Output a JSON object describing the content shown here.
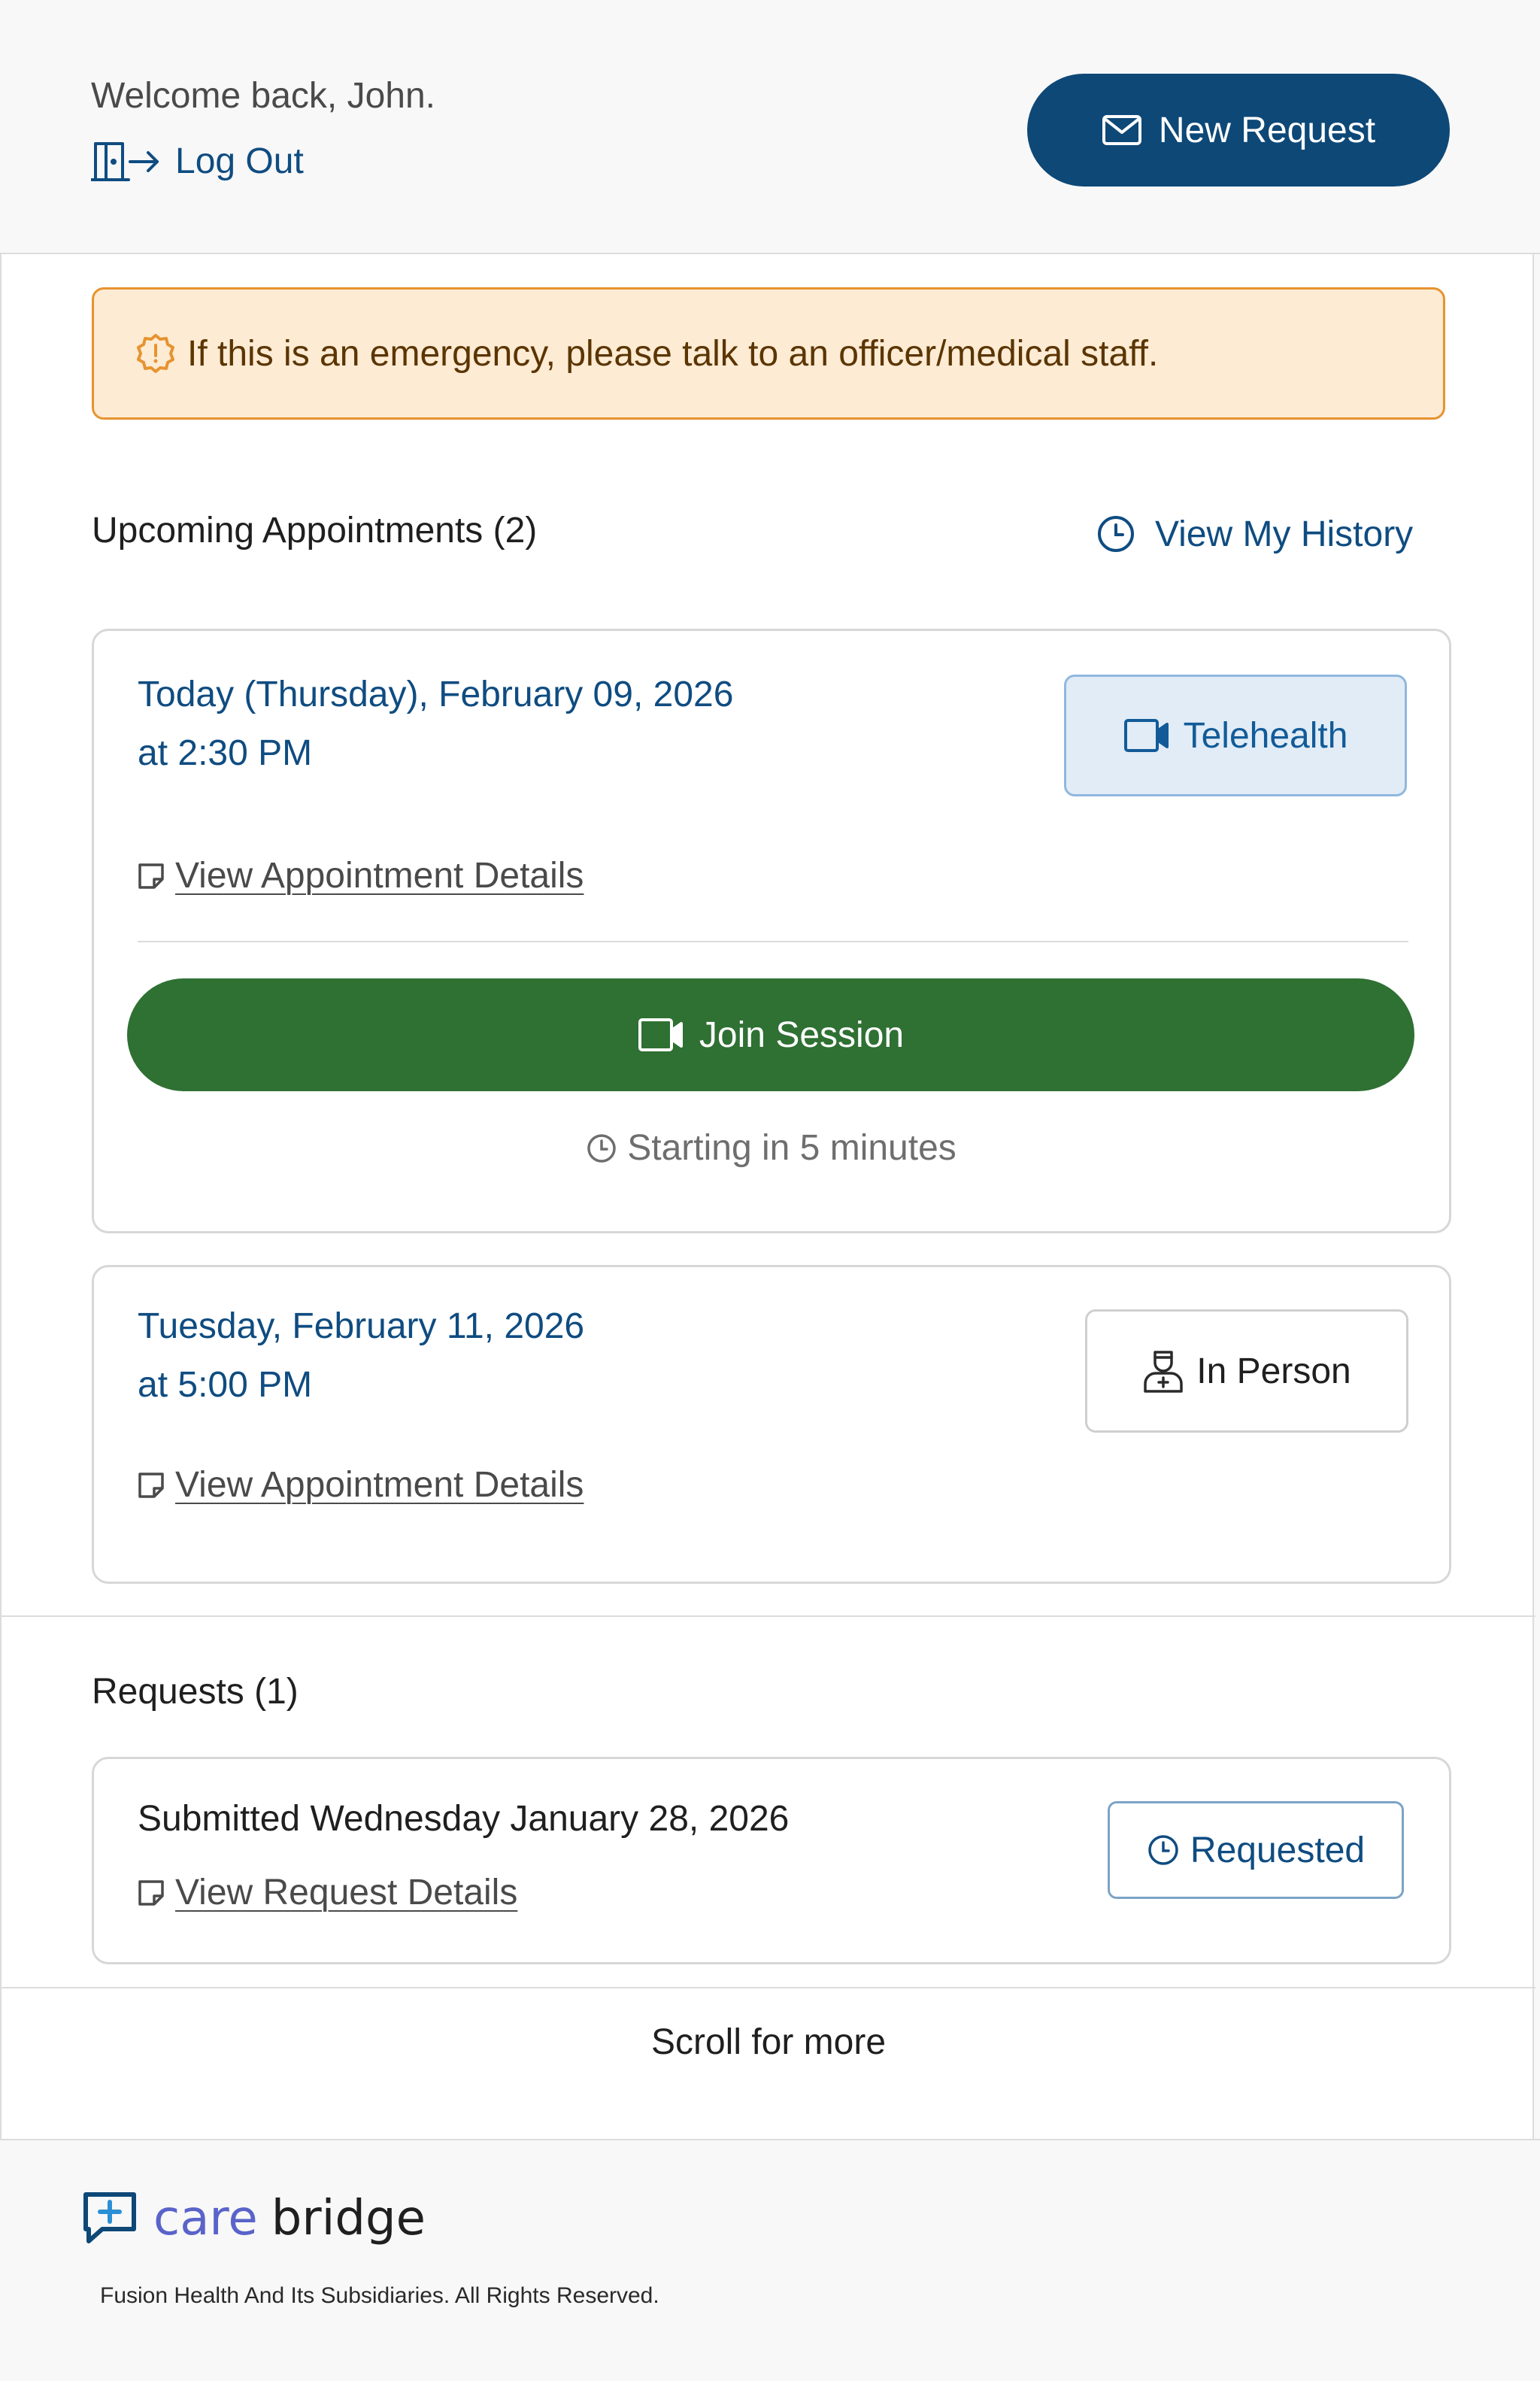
{
  "header": {
    "welcome": "Welcome back, John.",
    "logout_label": "Log Out",
    "new_request_label": "New Request"
  },
  "alert": {
    "text": "If this is an emergency, please talk to an officer/medical staff."
  },
  "appointments": {
    "title": "Upcoming Appointments (2)",
    "history_label": "View My History",
    "items": [
      {
        "date_line": "Today (Thursday), February 09, 2026",
        "time_line": "at 2:30 PM",
        "details_label": "View Appointment Details",
        "type_label": "Telehealth",
        "join_label": "Join Session",
        "starting_text": "Starting in 5 minutes"
      },
      {
        "date_line": "Tuesday, February 11, 2026",
        "time_line": "at 5:00 PM",
        "details_label": "View Appointment Details",
        "type_label": "In Person"
      }
    ]
  },
  "requests": {
    "title": "Requests (1)",
    "items": [
      {
        "submitted": "Submitted Wednesday January 28, 2026",
        "details_label": "View Request Details",
        "status_label": "Requested"
      }
    ]
  },
  "scroll_hint": "Scroll for more",
  "footer": {
    "brand_care": "care",
    "brand_bridge": "bridge",
    "copyright": "Fusion Health And Its Subsidiaries. All Rights Reserved."
  },
  "colors": {
    "primary": "#0d4877",
    "success": "#2f7033",
    "warning_bg": "#fdebd4",
    "warning_border": "#e6932f",
    "link": "#0f4c81"
  }
}
